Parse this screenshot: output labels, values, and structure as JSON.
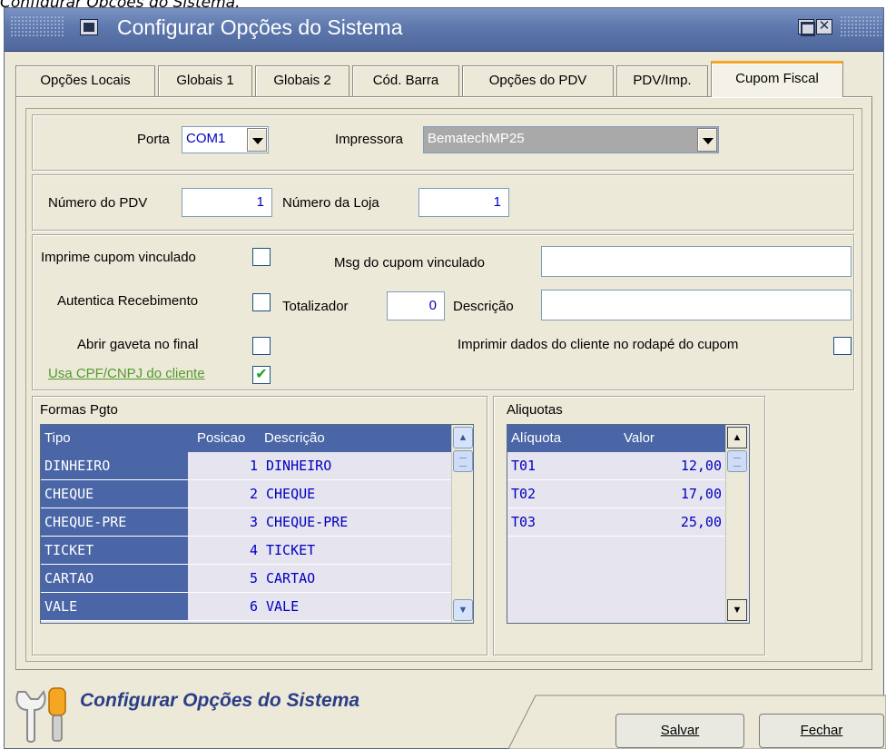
{
  "caption": "Configurar Opções do Sistema.",
  "window": {
    "title": "Configurar Opções do Sistema"
  },
  "tabs": [
    {
      "label": "Opções Locais"
    },
    {
      "label": "Globais 1"
    },
    {
      "label": "Globais 2"
    },
    {
      "label": "Cód. Barra"
    },
    {
      "label": "Opções do PDV"
    },
    {
      "label": "PDV/Imp."
    },
    {
      "label": "Cupom Fiscal",
      "active": true
    }
  ],
  "porta": {
    "label": "Porta",
    "value": "COM1"
  },
  "impressora": {
    "label": "Impressora",
    "value": "BematechMP25"
  },
  "numero_pdv": {
    "label": "Número do PDV",
    "value": "1"
  },
  "numero_loja": {
    "label": "Número da Loja",
    "value": "1"
  },
  "options": {
    "imprime_cupom_vinculado": {
      "label": "Imprime cupom vinculado",
      "checked": false
    },
    "msg_cupom_vinculado": {
      "label": "Msg do cupom vinculado",
      "value": ""
    },
    "autentica_recebimento": {
      "label": "Autentica Recebimento",
      "checked": false
    },
    "totalizador": {
      "label": "Totalizador",
      "value": "0"
    },
    "descricao": {
      "label": "Descrição",
      "value": ""
    },
    "abrir_gaveta": {
      "label": "Abrir gaveta no final",
      "checked": false
    },
    "imprimir_dados_cliente": {
      "label": "Imprimir dados do cliente no rodapé do cupom",
      "checked": false
    },
    "usa_cpf_cnpj": {
      "label": "Usa CPF/CNPJ do cliente",
      "checked": true,
      "check_mark": "✔"
    }
  },
  "formas_pgto": {
    "title": "Formas Pgto",
    "columns": [
      "Tipo",
      "Posicao",
      "Descrição"
    ],
    "rows": [
      {
        "tipo": "DINHEIRO",
        "posicao": "1",
        "descricao": "DINHEIRO"
      },
      {
        "tipo": "CHEQUE",
        "posicao": "2",
        "descricao": "CHEQUE"
      },
      {
        "tipo": "CHEQUE-PRE",
        "posicao": "3",
        "descricao": "CHEQUE-PRE"
      },
      {
        "tipo": "TICKET",
        "posicao": "4",
        "descricao": "TICKET"
      },
      {
        "tipo": "CARTAO",
        "posicao": "5",
        "descricao": "CARTAO"
      },
      {
        "tipo": "VALE",
        "posicao": "6",
        "descricao": "VALE"
      }
    ]
  },
  "aliquotas": {
    "title": "Aliquotas",
    "columns": [
      "Alíquota",
      "Valor"
    ],
    "rows": [
      {
        "aliquota": "T01",
        "valor": "12,00"
      },
      {
        "aliquota": "T02",
        "valor": "17,00"
      },
      {
        "aliquota": "T03",
        "valor": "25,00"
      }
    ]
  },
  "footer": {
    "title": "Configurar Opções do Sistema",
    "salvar": "Salvar",
    "fechar": "Fechar"
  },
  "colors": {
    "titlebar": "#5d78ad",
    "grid_header": "#4a66a6",
    "active_tab_accent": "#f5a623",
    "value_text": "#0000c0",
    "link_green": "#549a2e"
  }
}
